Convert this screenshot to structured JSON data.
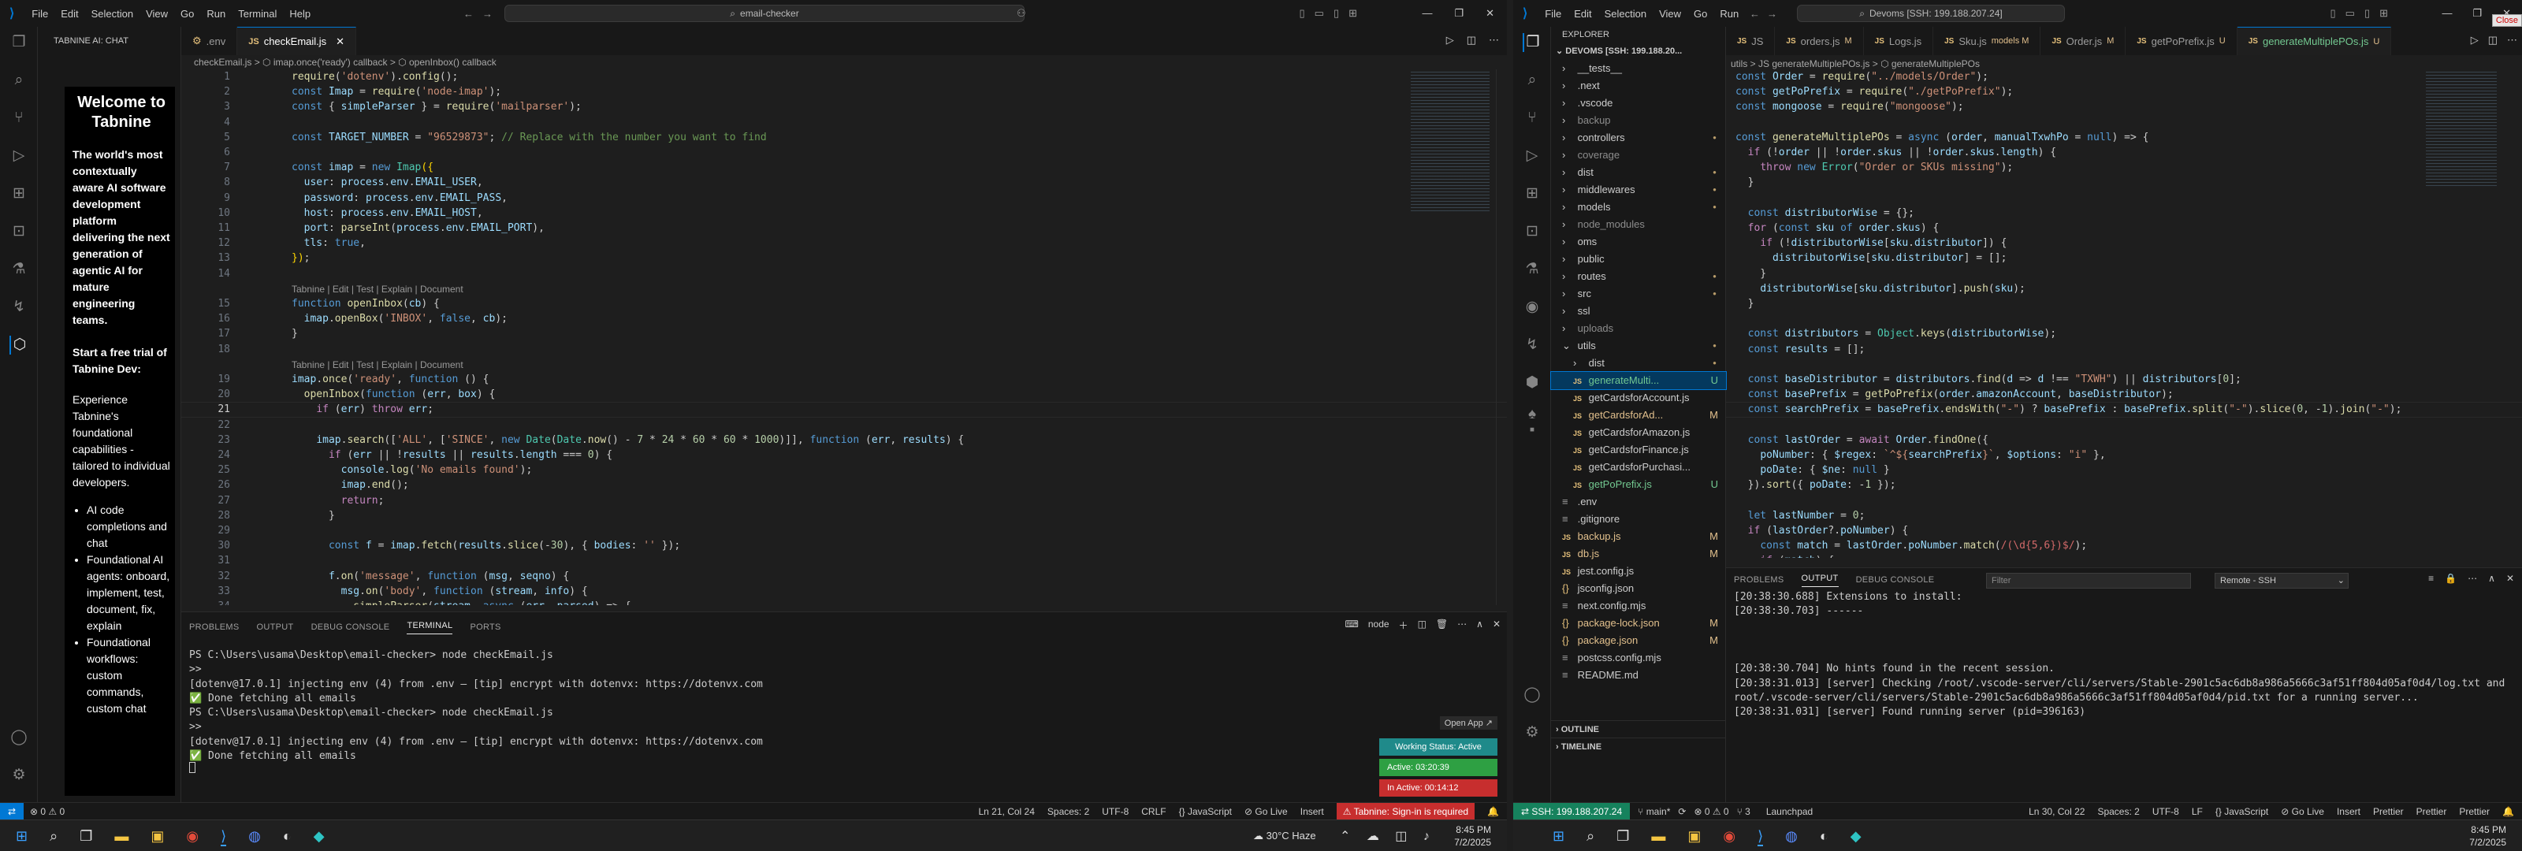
{
  "left": {
    "menu": [
      "File",
      "Edit",
      "Selection",
      "View",
      "Go",
      "Run",
      "Terminal",
      "Help"
    ],
    "search": "email-checker",
    "sidebar_title": "TABNINE AI: CHAT",
    "tabnine": {
      "heading": "Welcome to Tabnine",
      "para": "The world's most contextually aware AI software development platform delivering the next generation of agentic AI for mature engineering teams.",
      "trial": "Start a free trial of Tabnine Dev:",
      "exp": "Experience Tabnine's foundational capabilities - tailored to individual developers.",
      "bullets": [
        "AI code completions and chat",
        "Foundational AI agents: onboard, implement, test, document, fix, explain",
        "Foundational workflows: custom commands, custom chat"
      ]
    },
    "tabs": [
      ".env",
      "checkEmail.js"
    ],
    "breadcrumb": "checkEmail.js > ⬡ imap.once('ready') callback > ⬡ openInbox() callback",
    "lens": "Tabnine | Edit | Test | Explain | Document",
    "code": [
      {
        "ln": "1",
        "t": "<span class='f'>require</span>(<span class='s'>'dotenv'</span>).<span class='f'>config</span>();"
      },
      {
        "ln": "2",
        "t": "<span class='k'>const</span> <span class='v'>Imap</span> = <span class='f'>require</span>(<span class='s'>'node-imap'</span>);"
      },
      {
        "ln": "3",
        "t": "<span class='k'>const</span> { <span class='v'>simpleParser</span> } = <span class='f'>require</span>(<span class='s'>'mailparser'</span>);"
      },
      {
        "ln": "4",
        "t": ""
      },
      {
        "ln": "5",
        "t": "<span class='k'>const</span> <span class='v'>TARGET_NUMBER</span> = <span class='s'>\"96529873\"</span>; <span class='c'>// Replace with the number you want to find</span>"
      },
      {
        "ln": "6",
        "t": ""
      },
      {
        "ln": "7",
        "t": "<span class='k'>const</span> <span class='v'>imap</span> = <span class='k'>new</span> <span class='t'>Imap</span><span class='y'>({</span>"
      },
      {
        "ln": "8",
        "t": "  <span class='v'>user</span>: <span class='v'>process</span>.<span class='v'>env</span>.<span class='v'>EMAIL_USER</span>,"
      },
      {
        "ln": "9",
        "t": "  <span class='v'>password</span>: <span class='v'>process</span>.<span class='v'>env</span>.<span class='v'>EMAIL_PASS</span>,"
      },
      {
        "ln": "10",
        "t": "  <span class='v'>host</span>: <span class='v'>process</span>.<span class='v'>env</span>.<span class='v'>EMAIL_HOST</span>,"
      },
      {
        "ln": "11",
        "t": "  <span class='v'>port</span>: <span class='f'>parseInt</span>(<span class='v'>process</span>.<span class='v'>env</span>.<span class='v'>EMAIL_PORT</span>),"
      },
      {
        "ln": "12",
        "t": "  <span class='v'>tls</span>: <span class='k'>true</span>,"
      },
      {
        "ln": "13",
        "t": "<span class='y'>})</span>;"
      },
      {
        "ln": "14",
        "t": ""
      },
      {
        "lens": true
      },
      {
        "ln": "15",
        "t": "<span class='k'>function</span> <span class='f'>openInbox</span>(<span class='v'>cb</span>) {"
      },
      {
        "ln": "16",
        "t": "  <span class='v'>imap</span>.<span class='f'>openBox</span>(<span class='s'>'INBOX'</span>, <span class='k'>false</span>, <span class='v'>cb</span>);"
      },
      {
        "ln": "17",
        "t": "}"
      },
      {
        "ln": "18",
        "t": ""
      },
      {
        "lens": true
      },
      {
        "ln": "19",
        "t": "<span class='v'>imap</span>.<span class='f'>once</span>(<span class='s'>'ready'</span>, <span class='k'>function</span> () {"
      },
      {
        "ln": "20",
        "t": "  <span class='f'>openInbox</span>(<span class='k'>function</span> (<span class='v'>err</span>, <span class='v'>box</span>) {"
      },
      {
        "ln": "21",
        "t": "    <span class='p'>if</span> (<span class='v'>err</span>) <span class='p'>throw</span> <span class='v'>err</span>;",
        "cur": true
      },
      {
        "ln": "22",
        "t": ""
      },
      {
        "ln": "23",
        "t": "    <span class='v'>imap</span>.<span class='f'>search</span>([<span class='s'>'ALL'</span>, [<span class='s'>'SINCE'</span>, <span class='k'>new</span> <span class='t'>Date</span>(<span class='t'>Date</span>.<span class='f'>now</span>() - <span class='n'>7</span> * <span class='n'>24</span> * <span class='n'>60</span> * <span class='n'>60</span> * <span class='n'>1000</span>)]], <span class='k'>function</span> (<span class='v'>err</span>, <span class='v'>results</span>) {"
      },
      {
        "ln": "24",
        "t": "      <span class='p'>if</span> (<span class='v'>err</span> || !<span class='v'>results</span> || <span class='v'>results</span>.<span class='v'>length</span> === <span class='n'>0</span>) {"
      },
      {
        "ln": "25",
        "t": "        <span class='v'>console</span>.<span class='f'>log</span>(<span class='s'>'No emails found'</span>);"
      },
      {
        "ln": "26",
        "t": "        <span class='v'>imap</span>.<span class='f'>end</span>();"
      },
      {
        "ln": "27",
        "t": "        <span class='p'>return</span>;"
      },
      {
        "ln": "28",
        "t": "      }"
      },
      {
        "ln": "29",
        "t": ""
      },
      {
        "ln": "30",
        "t": "      <span class='k'>const</span> <span class='v'>f</span> = <span class='v'>imap</span>.<span class='f'>fetch</span>(<span class='v'>results</span>.<span class='f'>slice</span>(-<span class='n'>30</span>), { <span class='v'>bodies</span>: <span class='s'>''</span> });"
      },
      {
        "ln": "31",
        "t": ""
      },
      {
        "ln": "32",
        "t": "      <span class='v'>f</span>.<span class='f'>on</span>(<span class='s'>'message'</span>, <span class='k'>function</span> (<span class='v'>msg</span>, <span class='v'>seqno</span>) {"
      },
      {
        "ln": "33",
        "t": "        <span class='v'>msg</span>.<span class='f'>on</span>(<span class='s'>'body'</span>, <span class='k'>function</span> (<span class='v'>stream</span>, <span class='v'>info</span>) {"
      },
      {
        "ln": "34",
        "t": "          <span class='f'>simpleParser</span>(<span class='v'>stream</span>, <span class='k'>async</span> (<span class='v'>err</span>, <span class='v'>parsed</span>) => {"
      }
    ],
    "panel_tabs": [
      "PROBLEMS",
      "OUTPUT",
      "DEBUG CONSOLE",
      "TERMINAL",
      "PORTS"
    ],
    "terminal_label": "node",
    "terminal": [
      "PS C:\\Users\\usama\\Desktop\\email-checker> node checkEmail.js",
      ">>",
      "[dotenv@17.0.1] injecting env (4) from .env – [tip] encrypt with dotenvx: https://dotenvx.com",
      "✅ Done fetching all emails",
      "PS C:\\Users\\usama\\Desktop\\email-checker> node checkEmail.js",
      ">>",
      "[dotenv@17.0.1] injecting env (4) from .env – [tip] encrypt with dotenvx: https://dotenvx.com",
      "✅ Done fetching all emails"
    ],
    "open_app": "Open App ↗",
    "working_status": "Working Status: Active",
    "active": "Active: 03:20:39",
    "inactive": "In Active: 00:14:12",
    "status_left": "⊗ 0 ⚠ 0",
    "status_right": [
      "Ln 21, Col 24",
      "Spaces: 2",
      "UTF-8",
      "CRLF",
      "{} JavaScript",
      "⊘ Go Live",
      "Insert",
      "⚠ Tabnine: Sign-in is required"
    ]
  },
  "right": {
    "menu": [
      "File",
      "Edit",
      "Selection",
      "View",
      "Go",
      "Run"
    ],
    "search": "Devoms [SSH: 199.188.207.24]",
    "close_tip": "Close",
    "explorer_title": "EXPLORER",
    "tabs": [
      {
        "name": "JS",
        "m": ""
      },
      {
        "name": "orders.js",
        "m": "M"
      },
      {
        "name": "Logs.js",
        "m": ""
      },
      {
        "name": "Sku.js",
        "m": "models M"
      },
      {
        "name": "Order.js",
        "m": "M"
      },
      {
        "name": "getPoPrefix.js",
        "m": "U"
      },
      {
        "name": "generateMultiplePOs.js",
        "m": "U"
      }
    ],
    "breadcrumb": "utils > JS generateMultiplePOs.js > ⬡ generateMultiplePOs",
    "root": "DEVOMS [SSH: 199.188.20...",
    "tree": [
      {
        "label": "__tests__",
        "type": "folder",
        "ind": 1
      },
      {
        "label": ".next",
        "type": "folder",
        "ind": 1
      },
      {
        "label": ".vscode",
        "type": "folder",
        "ind": 1
      },
      {
        "label": "backup",
        "type": "folder",
        "ind": 1,
        "dim": true
      },
      {
        "label": "controllers",
        "type": "folder",
        "ind": 1,
        "dot": true
      },
      {
        "label": "coverage",
        "type": "folder",
        "ind": 1,
        "dim": true
      },
      {
        "label": "dist",
        "type": "folder",
        "ind": 1,
        "dot": true
      },
      {
        "label": "middlewares",
        "type": "folder",
        "ind": 1,
        "dot": true
      },
      {
        "label": "models",
        "type": "folder",
        "ind": 1,
        "dot": true
      },
      {
        "label": "node_modules",
        "type": "folder",
        "ind": 1,
        "dim": true
      },
      {
        "label": "oms",
        "type": "folder",
        "ind": 1
      },
      {
        "label": "public",
        "type": "folder",
        "ind": 1
      },
      {
        "label": "routes",
        "type": "folder",
        "ind": 1,
        "dot": true
      },
      {
        "label": "src",
        "type": "folder",
        "ind": 1,
        "dot": true
      },
      {
        "label": "ssl",
        "type": "folder",
        "ind": 1
      },
      {
        "label": "uploads",
        "type": "folder",
        "ind": 1,
        "dim": true
      },
      {
        "label": "utils",
        "type": "open",
        "ind": 1,
        "dot": true
      },
      {
        "label": "dist",
        "type": "folder",
        "ind": 2,
        "dot": true
      },
      {
        "label": "generateMulti...",
        "type": "js",
        "ind": 2,
        "badge": "U",
        "sel": true
      },
      {
        "label": "getCardsforAccount.js",
        "type": "js",
        "ind": 2
      },
      {
        "label": "getCardsforAd...",
        "type": "js",
        "ind": 2,
        "badge": "M"
      },
      {
        "label": "getCardsforAmazon.js",
        "type": "js",
        "ind": 2
      },
      {
        "label": "getCardsforFinance.js",
        "type": "js",
        "ind": 2
      },
      {
        "label": "getCardsforPurchasi...",
        "type": "js",
        "ind": 2
      },
      {
        "label": "getPoPrefix.js",
        "type": "js",
        "ind": 2,
        "badge": "U"
      },
      {
        "label": ".env",
        "type": "file",
        "ind": 1
      },
      {
        "label": ".gitignore",
        "type": "file",
        "ind": 1
      },
      {
        "label": "backup.js",
        "type": "js",
        "ind": 1,
        "badge": "M"
      },
      {
        "label": "db.js",
        "type": "js",
        "ind": 1,
        "badge": "M"
      },
      {
        "label": "jest.config.js",
        "type": "js",
        "ind": 1
      },
      {
        "label": "jsconfig.json",
        "type": "json",
        "ind": 1
      },
      {
        "label": "next.config.mjs",
        "type": "file",
        "ind": 1
      },
      {
        "label": "package-lock.json",
        "type": "json",
        "ind": 1,
        "badge": "M"
      },
      {
        "label": "package.json",
        "type": "json",
        "ind": 1,
        "badge": "M"
      },
      {
        "label": "postcss.config.mjs",
        "type": "file",
        "ind": 1
      },
      {
        "label": "README.md",
        "type": "file",
        "ind": 1
      }
    ],
    "outline": "OUTLINE",
    "timeline": "TIMELINE",
    "code": [
      "<span class='k'>const</span> <span class='v'>Order</span> = <span class='f'>require</span>(<span class='s'>\"../models/Order\"</span>);",
      "<span class='k'>const</span> <span class='v'>getPoPrefix</span> = <span class='f'>require</span>(<span class='s'>\"./getPoPrefix\"</span>);",
      "<span class='k'>const</span> <span class='v'>mongoose</span> = <span class='f'>require</span>(<span class='s'>\"mongoose\"</span>);",
      "",
      "<span class='k'>const</span> <span class='f'>generateMultiplePOs</span> = <span class='k'>async</span> (<span class='v'>order</span>, <span class='v'>manualTxwhPo</span> = <span class='k'>null</span>) => {",
      "  <span class='p'>if</span> (!<span class='v'>order</span> || !<span class='v'>order</span>.<span class='v'>skus</span> || !<span class='v'>order</span>.<span class='v'>skus</span>.<span class='v'>length</span>) {",
      "    <span class='p'>throw</span> <span class='k'>new</span> <span class='t'>Error</span>(<span class='s'>\"Order or SKUs missing\"</span>);",
      "  }",
      "",
      "  <span class='k'>const</span> <span class='v'>distributorWise</span> = {};",
      "  <span class='p'>for</span> (<span class='k'>const</span> <span class='v'>sku</span> <span class='k'>of</span> <span class='v'>order</span>.<span class='v'>skus</span>) {",
      "    <span class='p'>if</span> (!<span class='v'>distributorWise</span>[<span class='v'>sku</span>.<span class='v'>distributor</span>]) {",
      "      <span class='v'>distributorWise</span>[<span class='v'>sku</span>.<span class='v'>distributor</span>] = [];",
      "    }",
      "    <span class='v'>distributorWise</span>[<span class='v'>sku</span>.<span class='v'>distributor</span>].<span class='f'>push</span>(<span class='v'>sku</span>);",
      "  }",
      "",
      "  <span class='k'>const</span> <span class='v'>distributors</span> = <span class='t'>Object</span>.<span class='f'>keys</span>(<span class='v'>distributorWise</span>);",
      "  <span class='k'>const</span> <span class='v'>results</span> = [];",
      "",
      "  <span class='k'>const</span> <span class='v'>baseDistributor</span> = <span class='v'>distributors</span>.<span class='f'>find</span>(<span class='v'>d</span> => <span class='v'>d</span> !== <span class='s'>\"TXWH\"</span>) || <span class='v'>distributors</span>[<span class='n'>0</span>];",
      "  <span class='k'>const</span> <span class='v'>basePrefix</span> = <span class='f'>getPoPrefix</span>(<span class='v'>order</span>.<span class='v'>amazonAccount</span>, <span class='v'>baseDistributor</span>);",
      "  <span class='k'>const</span> <span class='v'>searchPrefix</span> = <span class='v'>basePrefix</span>.<span class='f'>endsWith</span>(<span class='s'>\"-\"</span>) ? <span class='v'>basePrefix</span> : <span class='v'>basePrefix</span>.<span class='f'>split</span>(<span class='s'>\"-\"</span>).<span class='f'>slice</span>(<span class='n'>0</span>, -<span class='n'>1</span>).<span class='f'>join</span>(<span class='s'>\"-\"</span>);",
      "",
      "  <span class='k'>const</span> <span class='v'>lastOrder</span> = <span class='p'>await</span> <span class='v'>Order</span>.<span class='f'>findOne</span>({",
      "    <span class='v'>poNumber</span>: { <span class='v'>$regex</span>: <span class='s'>`^${</span><span class='v'>searchPrefix</span><span class='s'>}`</span>, <span class='v'>$options</span>: <span class='s'>\"i\"</span> },",
      "    <span class='v'>poDate</span>: { <span class='v'>$ne</span>: <span class='k'>null</span> }",
      "  }).<span class='f'>sort</span>({ <span class='v'>poDate</span>: -<span class='n'>1</span> });",
      "",
      "  <span class='k'>let</span> <span class='v'>lastNumber</span> = <span class='n'>0</span>;",
      "  <span class='p'>if</span> (<span class='v'>lastOrder</span>?.<span class='v'>poNumber</span>) {",
      "    <span class='k'>const</span> <span class='v'>match</span> = <span class='v'>lastOrder</span>.<span class='v'>poNumber</span>.<span class='f'>match</span>(<span class='r'>/(\\d{5,6})$/</span>);",
      "    <span class='p'>if</span> (<span class='v'>match</span>) {"
    ],
    "code_ln_start": 8,
    "panel_tabs": [
      "PROBLEMS",
      "OUTPUT",
      "DEBUG CONSOLE"
    ],
    "filter_placeholder": "Filter",
    "output_select": "Remote - SSH",
    "output": [
      "[20:38:30.688] Extensions to install:",
      "[20:38:30.703] ------",
      "",
      "",
      "",
      "[20:38:30.704] No hints found in the recent session.",
      "[20:38:31.013] [server] Checking /root/.vscode-server/cli/servers/Stable-2901c5ac6db8a986a5666c3af51ff804d05af0d4/log.txt and",
      "root/.vscode-server/cli/servers/Stable-2901c5ac6db8a986a5666c3af51ff804d05af0d4/pid.txt for a running server...",
      "[20:38:31.031] [server] Found running server (pid=396163)"
    ],
    "status_left": [
      "⇄ SSH: 199.188.207.24",
      "⑂ main*",
      "⟳",
      "⊗ 0 ⚠ 0",
      "⑂ 3"
    ],
    "status_mid": [
      "Launchpad"
    ],
    "status_right": [
      "Ln 30, Col 22",
      "Spaces: 2",
      "UTF-8",
      "LF",
      "{} JavaScript",
      "⊘ Go Live",
      "Insert",
      "Prettier",
      "Prettier",
      "Prettier"
    ]
  },
  "taskbar_left": {
    "weather": "30°C Haze",
    "time": "8:45 PM",
    "date": "7/2/2025"
  },
  "taskbar_right": {
    "time": "8:45 PM",
    "date": "7/2/2025"
  },
  "colors": {
    "accent": "#0078d4",
    "status_ssh": "#16825d",
    "green": "#2ea043",
    "red": "#c72e2e",
    "teal": "#1f8a8a"
  }
}
